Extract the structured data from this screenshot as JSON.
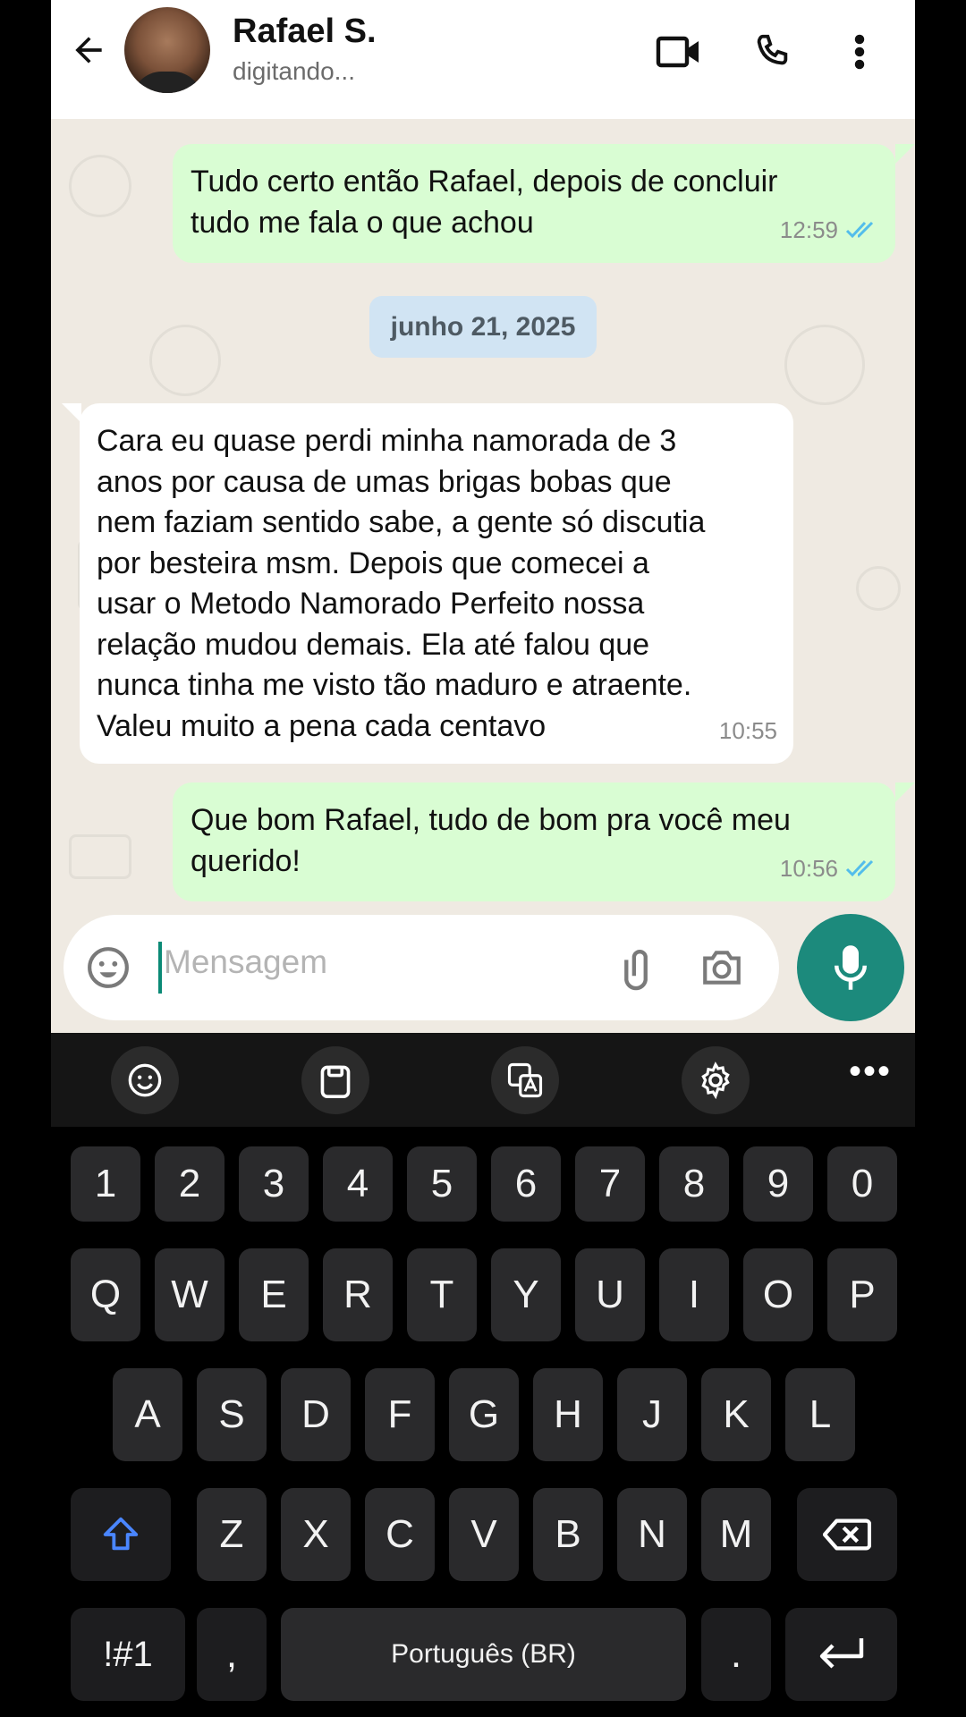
{
  "header": {
    "contact_name": "Rafael S.",
    "status": "digitando..."
  },
  "messages": [
    {
      "direction": "out",
      "text_lines": [
        "Tudo certo então Rafael, depois de concluir",
        "tudo me fala o que achou"
      ],
      "time": "12:59",
      "read": true
    },
    {
      "direction": "in",
      "text_lines": [
        "Cara eu quase perdi minha namorada de 3",
        "anos por causa de umas brigas bobas que",
        "nem faziam sentido sabe, a gente só discutia",
        "por besteira msm. Depois que comecei a",
        "usar o Metodo Namorado Perfeito nossa",
        "relação mudou demais. Ela até falou que",
        "nunca tinha me visto tão maduro e atraente.",
        "Valeu muito a pena cada centavo"
      ],
      "time": "10:55"
    },
    {
      "direction": "out",
      "text_lines": [
        "Que bom Rafael, tudo de bom pra você meu",
        "querido!"
      ],
      "time": "10:56",
      "read": true
    }
  ],
  "date_separator": "junho 21, 2025",
  "composer": {
    "placeholder": "Mensagem"
  },
  "keyboard": {
    "number_row": [
      "1",
      "2",
      "3",
      "4",
      "5",
      "6",
      "7",
      "8",
      "9",
      "0"
    ],
    "row1": [
      "Q",
      "W",
      "E",
      "R",
      "T",
      "Y",
      "U",
      "I",
      "O",
      "P"
    ],
    "row2": [
      "A",
      "S",
      "D",
      "F",
      "G",
      "H",
      "J",
      "K",
      "L"
    ],
    "row3": [
      "Z",
      "X",
      "C",
      "V",
      "B",
      "N",
      "M"
    ],
    "symbols_key": "!#1",
    "comma_key": ",",
    "space_label": "Português (BR)",
    "period_key": "."
  },
  "colors": {
    "chat_background": "#efeae2",
    "outgoing_bubble": "#d9fdd3",
    "incoming_bubble": "#ffffff",
    "accent": "#1c8a7c",
    "read_ticks": "#53bdeb"
  },
  "icons": [
    "back-arrow-icon",
    "video-call-icon",
    "phone-icon",
    "more-vert-icon",
    "emoji-icon",
    "attach-icon",
    "camera-icon",
    "mic-icon",
    "double-check-icon",
    "emoji-panel-icon",
    "clipboard-icon",
    "translate-icon",
    "settings-icon",
    "shift-icon",
    "backspace-icon",
    "enter-icon"
  ]
}
